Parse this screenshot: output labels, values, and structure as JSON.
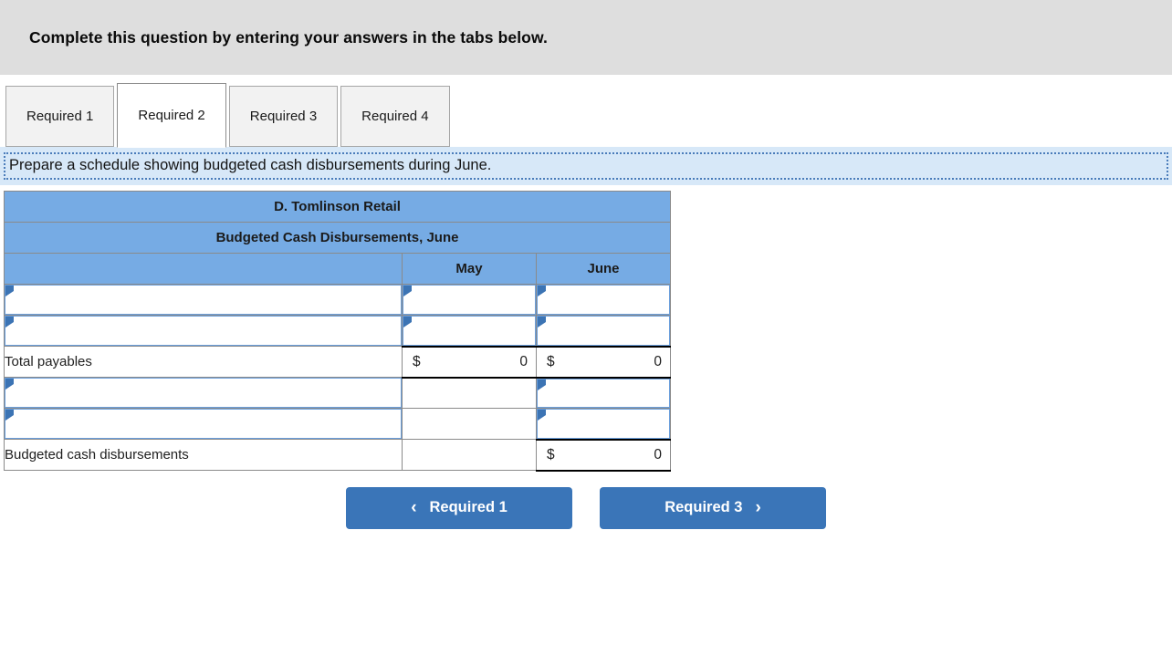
{
  "banner": {
    "text": "Complete this question by entering your answers in the tabs below."
  },
  "tabs": [
    {
      "label": "Required 1",
      "active": false
    },
    {
      "label": "Required 2",
      "active": true
    },
    {
      "label": "Required 3",
      "active": false
    },
    {
      "label": "Required 4",
      "active": false
    }
  ],
  "instruction": {
    "text": "Prepare a schedule showing budgeted cash disbursements during June."
  },
  "worksheet": {
    "title_line1": "D. Tomlinson Retail",
    "title_line2": "Budgeted Cash Disbursements, June",
    "columns": {
      "label": "",
      "may": "May",
      "june": "June"
    },
    "rows": [
      {
        "type": "input",
        "label": "",
        "may": {
          "kind": "input",
          "value": ""
        },
        "june": {
          "kind": "input",
          "value": ""
        }
      },
      {
        "type": "input",
        "label": "",
        "may": {
          "kind": "input",
          "value": ""
        },
        "june": {
          "kind": "input",
          "value": ""
        }
      },
      {
        "type": "total",
        "label": "Total payables",
        "may": {
          "kind": "total",
          "currency": "$",
          "value": "0"
        },
        "june": {
          "kind": "total",
          "currency": "$",
          "value": "0"
        }
      },
      {
        "type": "input",
        "label": "",
        "may": {
          "kind": "blank",
          "value": ""
        },
        "june": {
          "kind": "input",
          "value": ""
        }
      },
      {
        "type": "input",
        "label": "",
        "may": {
          "kind": "blank",
          "value": ""
        },
        "june": {
          "kind": "input",
          "value": ""
        }
      },
      {
        "type": "total",
        "label": "Budgeted cash disbursements",
        "may": {
          "kind": "blank",
          "value": ""
        },
        "june": {
          "kind": "total",
          "currency": "$",
          "value": "0"
        }
      }
    ]
  },
  "nav": {
    "prev_label": "Required 1",
    "prev_icon": "chevron-left-icon",
    "prev_chevron": "‹",
    "next_label": "Required 3",
    "next_icon": "chevron-right-icon",
    "next_chevron": "›"
  },
  "colors": {
    "banner_bg": "#dedede",
    "instruction_bg": "#d7e8f8",
    "instruction_border": "#4a7cba",
    "table_header_bg": "#76abe4",
    "input_border": "#6a9edb",
    "button_bg": "#3a75b8"
  }
}
